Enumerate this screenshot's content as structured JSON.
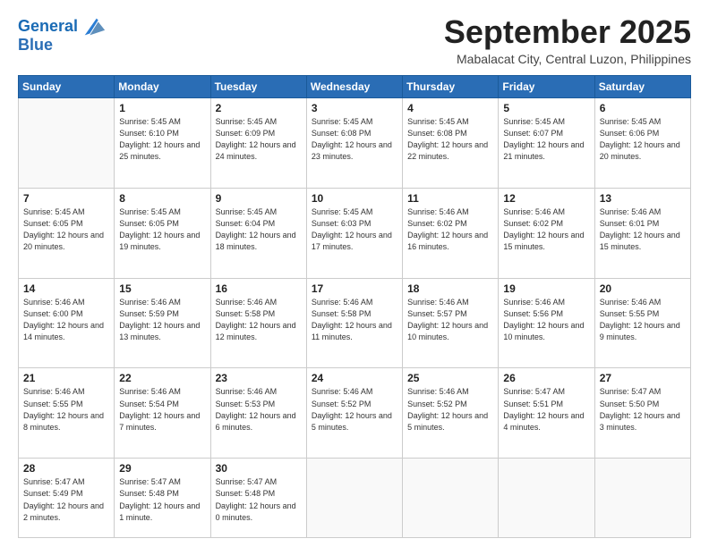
{
  "logo": {
    "line1": "General",
    "line2": "Blue"
  },
  "header": {
    "month": "September 2025",
    "location": "Mabalacat City, Central Luzon, Philippines"
  },
  "weekdays": [
    "Sunday",
    "Monday",
    "Tuesday",
    "Wednesday",
    "Thursday",
    "Friday",
    "Saturday"
  ],
  "weeks": [
    [
      null,
      {
        "day": 1,
        "sunrise": "5:45 AM",
        "sunset": "6:10 PM",
        "daylight": "12 hours and 25 minutes."
      },
      {
        "day": 2,
        "sunrise": "5:45 AM",
        "sunset": "6:09 PM",
        "daylight": "12 hours and 24 minutes."
      },
      {
        "day": 3,
        "sunrise": "5:45 AM",
        "sunset": "6:08 PM",
        "daylight": "12 hours and 23 minutes."
      },
      {
        "day": 4,
        "sunrise": "5:45 AM",
        "sunset": "6:08 PM",
        "daylight": "12 hours and 22 minutes."
      },
      {
        "day": 5,
        "sunrise": "5:45 AM",
        "sunset": "6:07 PM",
        "daylight": "12 hours and 21 minutes."
      },
      {
        "day": 6,
        "sunrise": "5:45 AM",
        "sunset": "6:06 PM",
        "daylight": "12 hours and 20 minutes."
      }
    ],
    [
      {
        "day": 7,
        "sunrise": "5:45 AM",
        "sunset": "6:05 PM",
        "daylight": "12 hours and 20 minutes."
      },
      {
        "day": 8,
        "sunrise": "5:45 AM",
        "sunset": "6:05 PM",
        "daylight": "12 hours and 19 minutes."
      },
      {
        "day": 9,
        "sunrise": "5:45 AM",
        "sunset": "6:04 PM",
        "daylight": "12 hours and 18 minutes."
      },
      {
        "day": 10,
        "sunrise": "5:45 AM",
        "sunset": "6:03 PM",
        "daylight": "12 hours and 17 minutes."
      },
      {
        "day": 11,
        "sunrise": "5:46 AM",
        "sunset": "6:02 PM",
        "daylight": "12 hours and 16 minutes."
      },
      {
        "day": 12,
        "sunrise": "5:46 AM",
        "sunset": "6:02 PM",
        "daylight": "12 hours and 15 minutes."
      },
      {
        "day": 13,
        "sunrise": "5:46 AM",
        "sunset": "6:01 PM",
        "daylight": "12 hours and 15 minutes."
      }
    ],
    [
      {
        "day": 14,
        "sunrise": "5:46 AM",
        "sunset": "6:00 PM",
        "daylight": "12 hours and 14 minutes."
      },
      {
        "day": 15,
        "sunrise": "5:46 AM",
        "sunset": "5:59 PM",
        "daylight": "12 hours and 13 minutes."
      },
      {
        "day": 16,
        "sunrise": "5:46 AM",
        "sunset": "5:58 PM",
        "daylight": "12 hours and 12 minutes."
      },
      {
        "day": 17,
        "sunrise": "5:46 AM",
        "sunset": "5:58 PM",
        "daylight": "12 hours and 11 minutes."
      },
      {
        "day": 18,
        "sunrise": "5:46 AM",
        "sunset": "5:57 PM",
        "daylight": "12 hours and 10 minutes."
      },
      {
        "day": 19,
        "sunrise": "5:46 AM",
        "sunset": "5:56 PM",
        "daylight": "12 hours and 10 minutes."
      },
      {
        "day": 20,
        "sunrise": "5:46 AM",
        "sunset": "5:55 PM",
        "daylight": "12 hours and 9 minutes."
      }
    ],
    [
      {
        "day": 21,
        "sunrise": "5:46 AM",
        "sunset": "5:55 PM",
        "daylight": "12 hours and 8 minutes."
      },
      {
        "day": 22,
        "sunrise": "5:46 AM",
        "sunset": "5:54 PM",
        "daylight": "12 hours and 7 minutes."
      },
      {
        "day": 23,
        "sunrise": "5:46 AM",
        "sunset": "5:53 PM",
        "daylight": "12 hours and 6 minutes."
      },
      {
        "day": 24,
        "sunrise": "5:46 AM",
        "sunset": "5:52 PM",
        "daylight": "12 hours and 5 minutes."
      },
      {
        "day": 25,
        "sunrise": "5:46 AM",
        "sunset": "5:52 PM",
        "daylight": "12 hours and 5 minutes."
      },
      {
        "day": 26,
        "sunrise": "5:47 AM",
        "sunset": "5:51 PM",
        "daylight": "12 hours and 4 minutes."
      },
      {
        "day": 27,
        "sunrise": "5:47 AM",
        "sunset": "5:50 PM",
        "daylight": "12 hours and 3 minutes."
      }
    ],
    [
      {
        "day": 28,
        "sunrise": "5:47 AM",
        "sunset": "5:49 PM",
        "daylight": "12 hours and 2 minutes."
      },
      {
        "day": 29,
        "sunrise": "5:47 AM",
        "sunset": "5:48 PM",
        "daylight": "12 hours and 1 minute."
      },
      {
        "day": 30,
        "sunrise": "5:47 AM",
        "sunset": "5:48 PM",
        "daylight": "12 hours and 0 minutes."
      },
      null,
      null,
      null,
      null
    ]
  ]
}
